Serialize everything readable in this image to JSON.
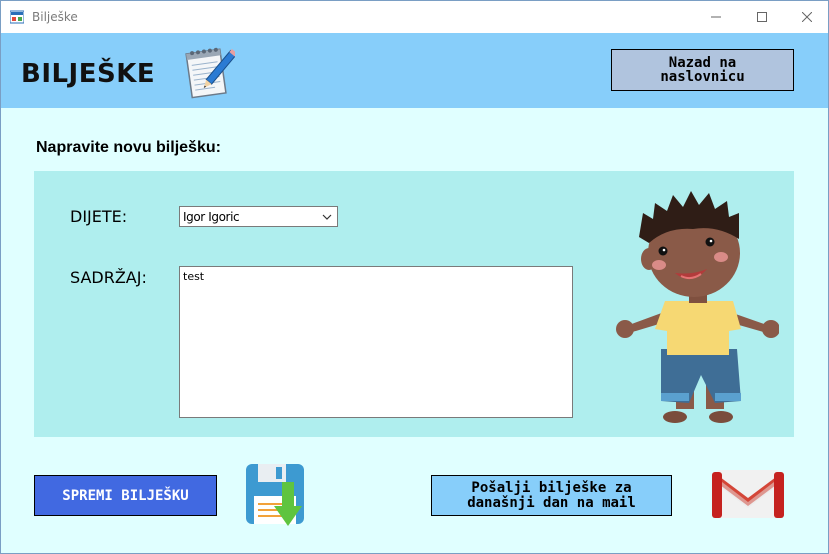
{
  "window": {
    "title": "Bilješke",
    "controls": {
      "minimize": "minimize-icon",
      "maximize": "maximize-icon",
      "close": "close-icon"
    }
  },
  "header": {
    "title": "BILJEŠKE",
    "icon": "notepad-pencil-icon",
    "back_button_label": "Nazad na\nnaslovnicu"
  },
  "main": {
    "subtitle": "Napravite novu bilješku:",
    "child_label": "DIJETE:",
    "child_selected": "Igor Igoric",
    "content_label": "SADRŽAJ:",
    "content_value": "test",
    "illustration": "child-illustration"
  },
  "actions": {
    "save_label": "SPREMI BILJEŠKU",
    "save_icon": "floppy-disk-download-icon",
    "mail_label": "Pošalji bilješke za\ndanašnji dan na mail",
    "mail_icon": "gmail-icon"
  },
  "colors": {
    "header_bg": "#87CEFA",
    "content_bg": "#E0FFFF",
    "panel_bg": "#AFEEEE",
    "back_button_bg": "#B0C4DE",
    "save_button_bg": "#4169E1",
    "mail_button_bg": "#87CEFA"
  }
}
